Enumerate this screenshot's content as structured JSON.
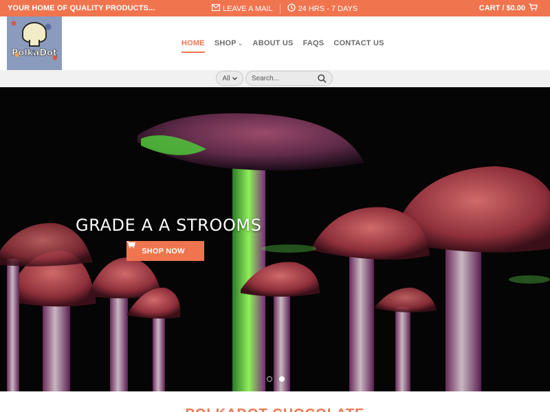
{
  "topbar": {
    "tagline": "YOUR HOME OF QUALITY PRODUCTS...",
    "mail_label": "LEAVE A MAIL",
    "hours_label": "24 HRS - 7 DAYS",
    "cart_label": "CART / $0.00"
  },
  "logo": {
    "text": "PolkaDot"
  },
  "nav": {
    "items": [
      {
        "label": "HOME",
        "active": true
      },
      {
        "label": "SHOP",
        "has_dropdown": true
      },
      {
        "label": "ABOUT US"
      },
      {
        "label": "FAQS"
      },
      {
        "label": "CONTACT US"
      }
    ]
  },
  "search": {
    "category_value": "All",
    "placeholder": "Search..."
  },
  "hero": {
    "headline": "GRADE A A STROOMS",
    "button_label": "SHOP NOW",
    "slides_total": 2,
    "active_slide": 2
  },
  "section": {
    "title": "POLKADOT CHOCOLATE"
  },
  "colors": {
    "accent": "#f0754f",
    "nav_text": "#6b6b6b",
    "hero_bg": "#050505"
  },
  "icons": {
    "mail": "envelope-icon",
    "clock": "clock-icon",
    "cart": "cart-icon",
    "search": "search-icon",
    "chevron": "chevron-down-icon"
  }
}
